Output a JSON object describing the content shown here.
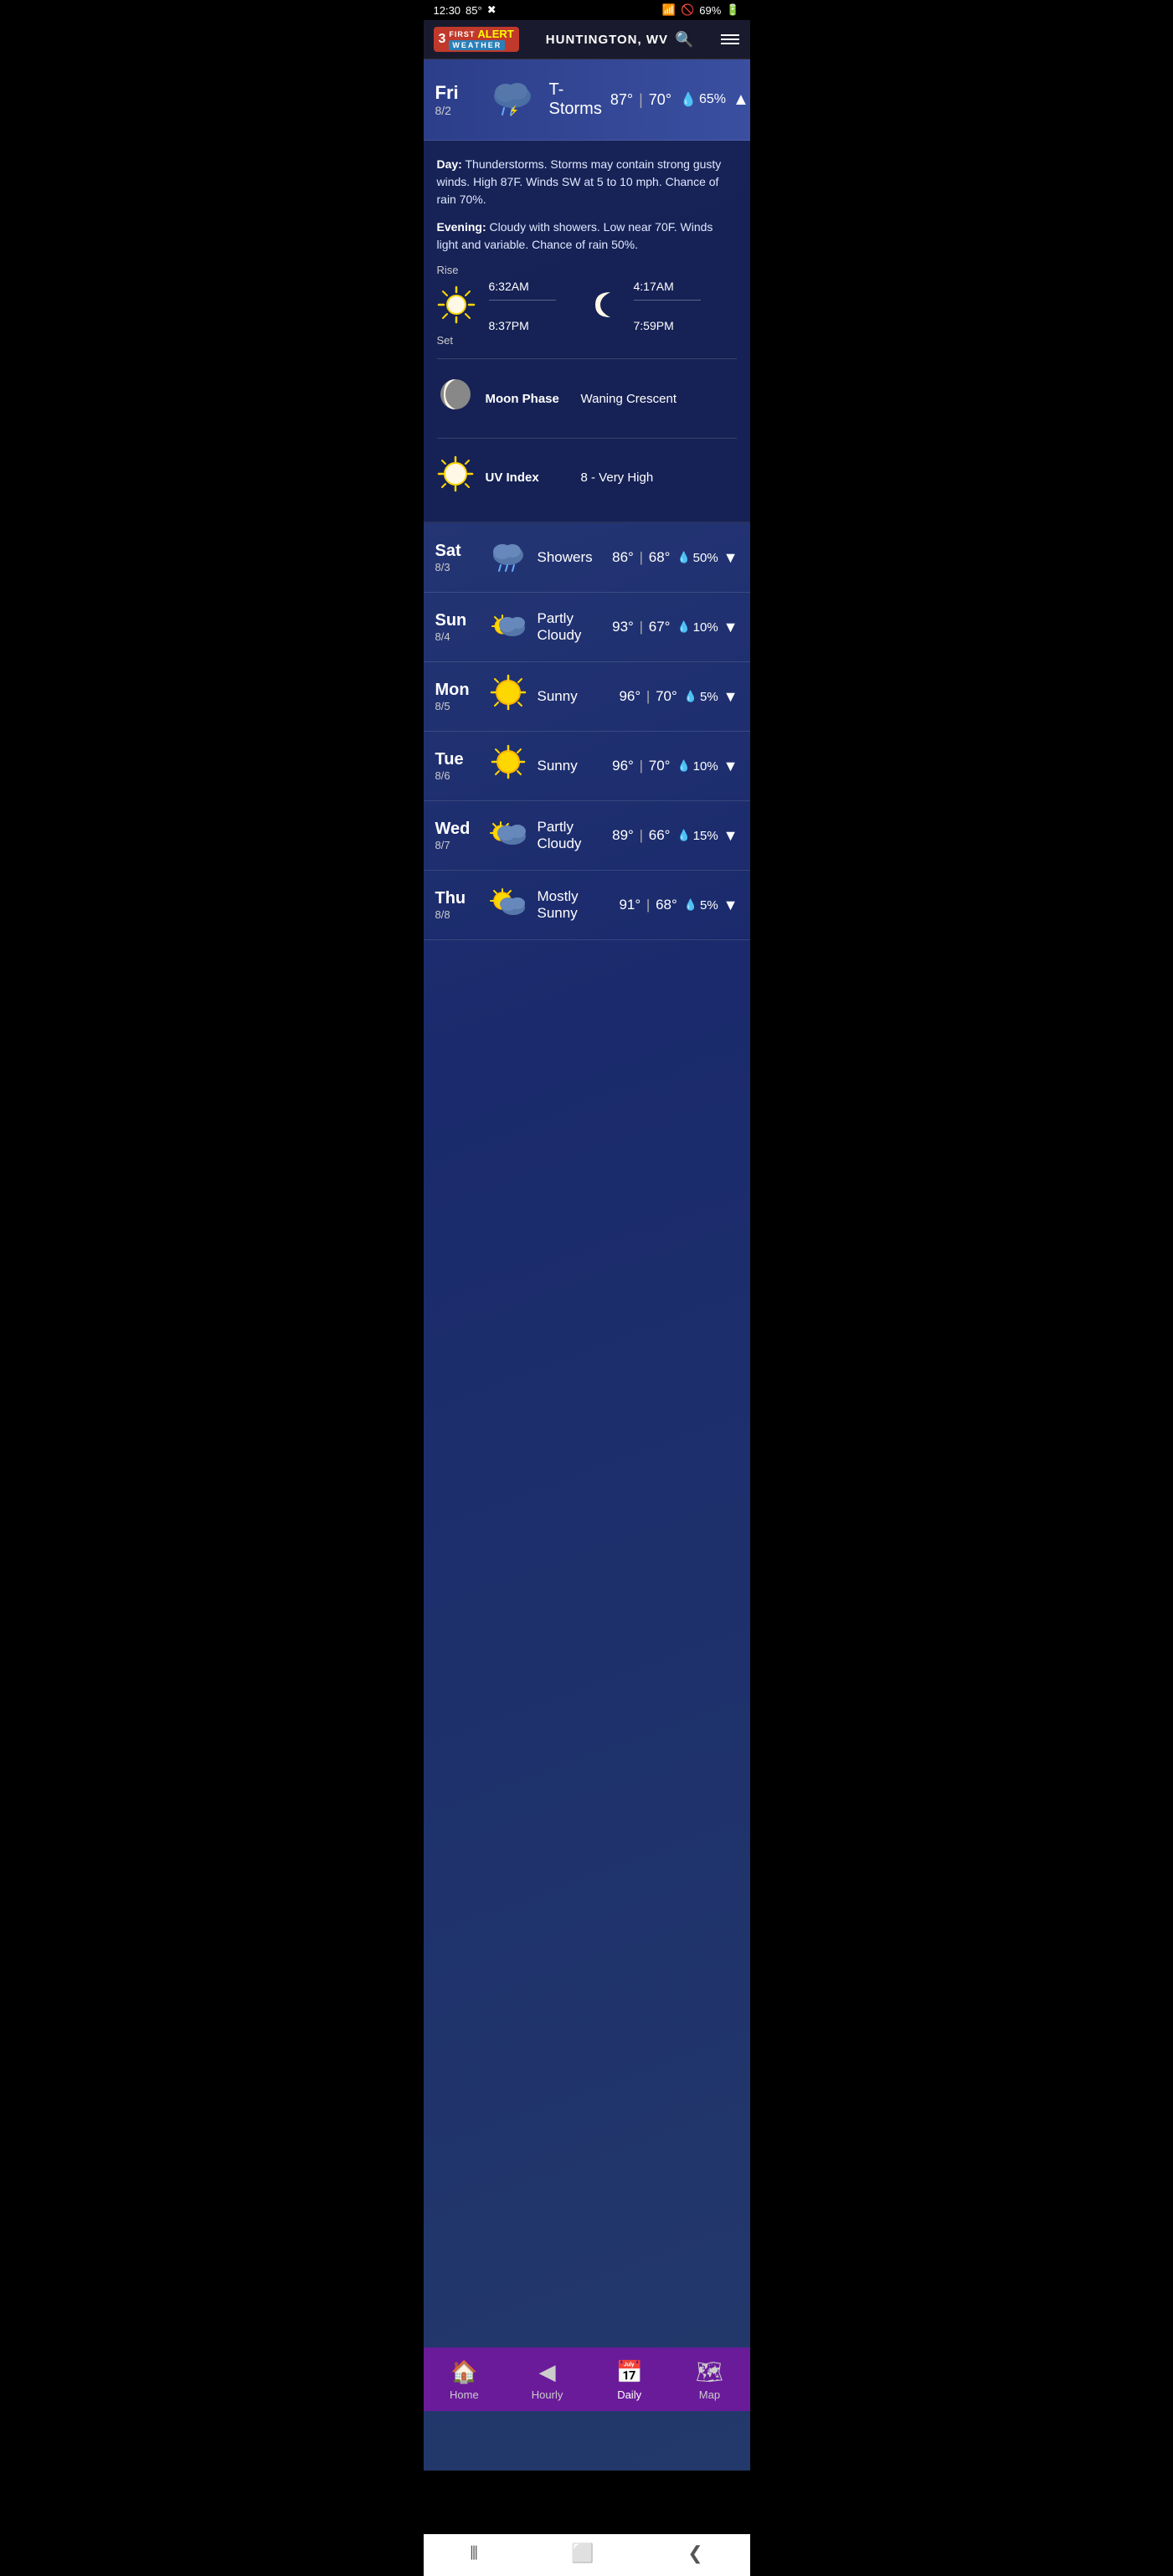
{
  "statusBar": {
    "time": "12:30",
    "temperature": "85°",
    "batteryPercent": "69%"
  },
  "header": {
    "logoNumber": "3",
    "logoFirst": "FIRST",
    "logoAlert": "ALERT",
    "logoWeather": "WEATHER",
    "location": "HUNTINGTON, WV"
  },
  "todayForecast": {
    "dayName": "Fri",
    "dayDate": "8/2",
    "condition": "T-Storms",
    "highTemp": "87°",
    "lowTemp": "70°",
    "precipChance": "65%",
    "expanded": true,
    "dayDescription": "Thunderstorms. Storms may contain strong gusty winds. High 87F. Winds SW at 5 to 10 mph. Chance of rain 70%.",
    "eveningDescription": "Cloudy with showers. Low near 70F. Winds light and variable. Chance of rain 50%.",
    "sunRise": "6:32AM",
    "sunSet": "8:37PM",
    "moonRise": "4:17AM",
    "moonSet": "7:59PM",
    "moonPhase": "Waning Crescent",
    "uvIndex": "8 - Very High",
    "riseLabel": "Rise",
    "setLabel": "Set"
  },
  "forecasts": [
    {
      "dayName": "Sat",
      "dayDate": "8/3",
      "condition": "Showers",
      "highTemp": "86°",
      "lowTemp": "68°",
      "precipChance": "50%",
      "iconType": "cloud-rain"
    },
    {
      "dayName": "Sun",
      "dayDate": "8/4",
      "condition": "Partly\nCloudy",
      "conditionLine1": "Partly",
      "conditionLine2": "Cloudy",
      "highTemp": "93°",
      "lowTemp": "67°",
      "precipChance": "10%",
      "iconType": "partly-cloudy"
    },
    {
      "dayName": "Mon",
      "dayDate": "8/5",
      "condition": "Sunny",
      "highTemp": "96°",
      "lowTemp": "70°",
      "precipChance": "5%",
      "iconType": "sunny"
    },
    {
      "dayName": "Tue",
      "dayDate": "8/6",
      "condition": "Sunny",
      "highTemp": "96°",
      "lowTemp": "70°",
      "precipChance": "10%",
      "iconType": "sunny"
    },
    {
      "dayName": "Wed",
      "dayDate": "8/7",
      "conditionLine1": "Partly",
      "conditionLine2": "Cloudy",
      "highTemp": "89°",
      "lowTemp": "66°",
      "precipChance": "15%",
      "iconType": "partly-cloudy"
    },
    {
      "dayName": "Thu",
      "dayDate": "8/8",
      "conditionLine1": "Mostly",
      "conditionLine2": "Sunny",
      "highTemp": "91°",
      "lowTemp": "68°",
      "precipChance": "5%",
      "iconType": "mostly-sunny"
    }
  ],
  "bottomNav": {
    "items": [
      {
        "label": "Home",
        "icon": "🏠",
        "active": false
      },
      {
        "label": "Hourly",
        "icon": "◀",
        "active": false
      },
      {
        "label": "Daily",
        "icon": "📅",
        "active": true
      },
      {
        "label": "Map",
        "icon": "🗺",
        "active": false
      }
    ]
  },
  "sysNav": {
    "backBtn": "❮",
    "homeBtn": "⬜",
    "recentBtn": "⦀"
  }
}
